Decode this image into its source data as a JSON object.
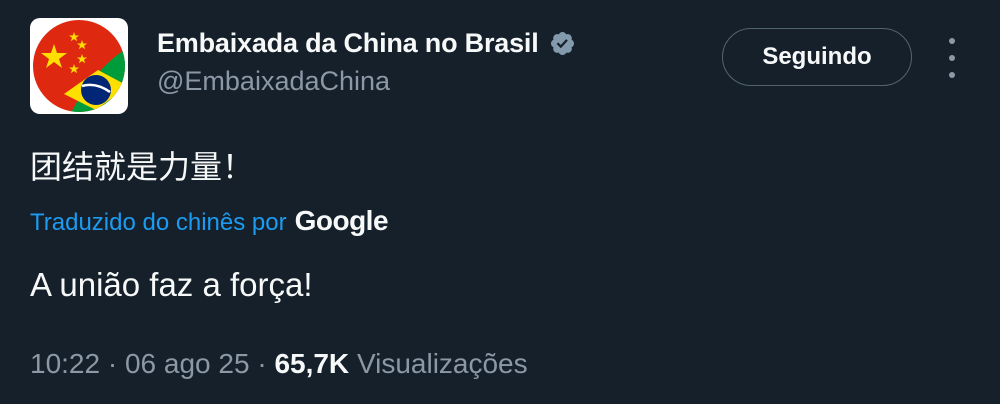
{
  "account": {
    "display_name": "Embaixada da China no Brasil",
    "handle": "@EmbaixadaChina",
    "verified": true,
    "verified_color": "#829aab",
    "avatar_icon": "china-brazil-flag-avatar"
  },
  "follow_button": {
    "label": "Seguindo"
  },
  "more_menu": {
    "icon": "more-vertical-icon"
  },
  "tweet": {
    "original_text": "团结就是力量！",
    "translation_label": "Traduzido do chinês por",
    "translation_provider": "Google",
    "translated_text": "A união faz a força!"
  },
  "meta": {
    "time": "10:22",
    "separator": " · ",
    "date": "06 ago 25",
    "views_count": "65,7K",
    "views_label": "Visualizações"
  },
  "colors": {
    "background": "#15202b",
    "text_primary": "#f7f9f9",
    "text_secondary": "#8b98a5",
    "link_blue": "#1d9bf0"
  }
}
